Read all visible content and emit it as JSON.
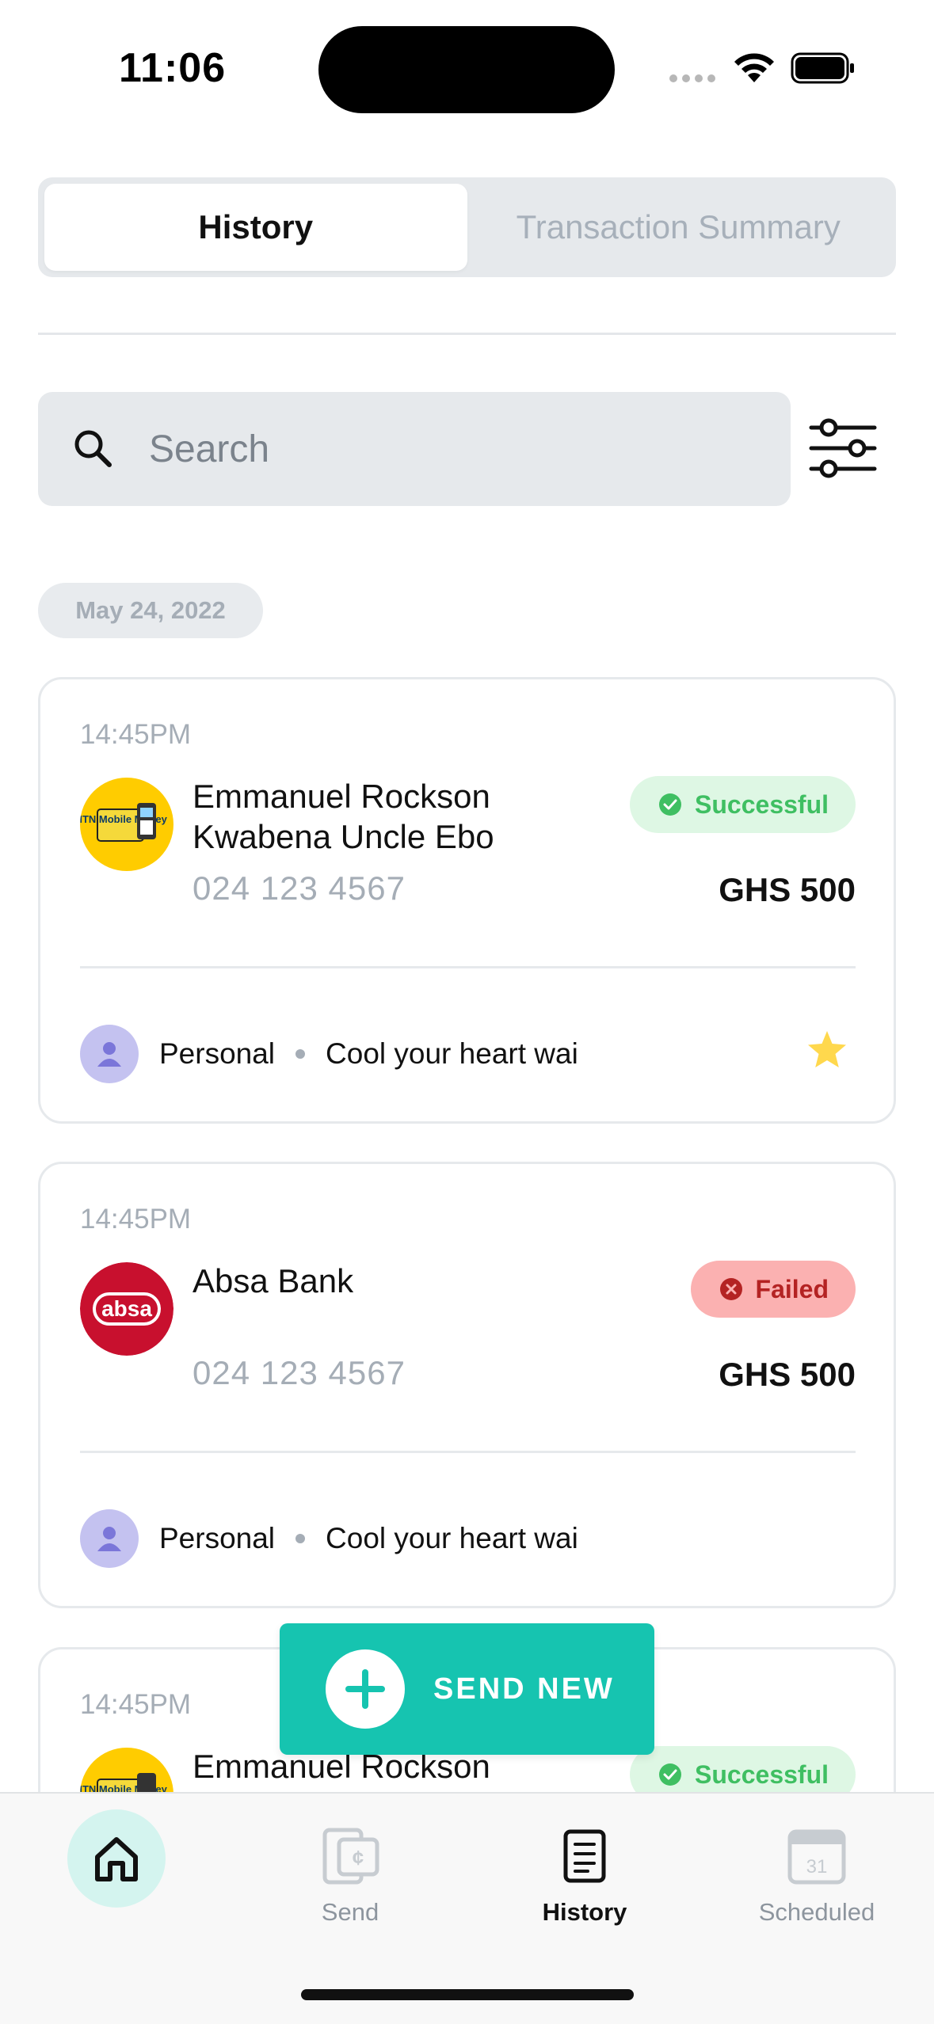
{
  "status_bar": {
    "time": "11:06"
  },
  "tabs": [
    {
      "label": "History",
      "active": true
    },
    {
      "label": "Transaction Summary",
      "active": false
    }
  ],
  "search": {
    "placeholder": "Search"
  },
  "date_group": "May 24, 2022",
  "transactions": [
    {
      "time": "14:45PM",
      "provider": "MTN Mobile Money",
      "provider_icon": "mtn-momo-logo",
      "name": "Emmanuel Rockson Kwabena Uncle Ebo",
      "phone": "024 123 4567",
      "status": "Successful",
      "amount": "GHS 500",
      "category": "Personal",
      "note": "Cool your heart wai",
      "starred": true
    },
    {
      "time": "14:45PM",
      "provider": "absa",
      "provider_icon": "absa-bank-logo",
      "name": "Absa Bank",
      "phone": "024 123 4567",
      "status": "Failed",
      "amount": "GHS 500",
      "category": "Personal",
      "note": "Cool your heart wai",
      "starred": false
    },
    {
      "time": "14:45PM",
      "provider": "MTN Mobile Money",
      "provider_icon": "mtn-momo-logo",
      "name": "Emmanuel Rockson",
      "status": "Successful"
    }
  ],
  "fab": {
    "label": "SEND NEW"
  },
  "bottom_nav": [
    {
      "label": "",
      "icon": "home-icon",
      "active": false
    },
    {
      "label": "Send",
      "icon": "send-money-icon",
      "active": false
    },
    {
      "label": "History",
      "icon": "history-icon",
      "active": true
    },
    {
      "label": "Scheduled",
      "icon": "calendar-icon",
      "active": false,
      "calendar_day": "31"
    }
  ],
  "colors": {
    "accent": "#16c4b0",
    "success_bg": "#def7e4",
    "success_text": "#3fbf62",
    "failed_bg": "#fbb1b1",
    "failed_text": "#b42323",
    "mtn_yellow": "#ffcc00",
    "absa_red": "#c8102e"
  }
}
